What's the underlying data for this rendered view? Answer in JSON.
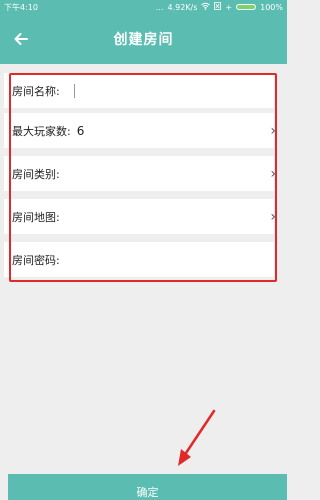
{
  "status_bar": {
    "time": "下午4:10",
    "signal": "...",
    "speed": "4.92K/s",
    "battery_pct": "100%"
  },
  "app_bar": {
    "title": "创建房间",
    "back_icon": "arrow-left-icon"
  },
  "form": {
    "room_name_label": "房间名称:",
    "room_name_value": "",
    "max_players_label": "最大玩家数:",
    "max_players_value": "6",
    "room_type_label": "房间类别:",
    "room_map_label": "房间地图:",
    "room_password_label": "房间密码:"
  },
  "confirm_label": "确定",
  "colors": {
    "accent": "#5bbcb1",
    "annotation": "#e02a2a"
  }
}
